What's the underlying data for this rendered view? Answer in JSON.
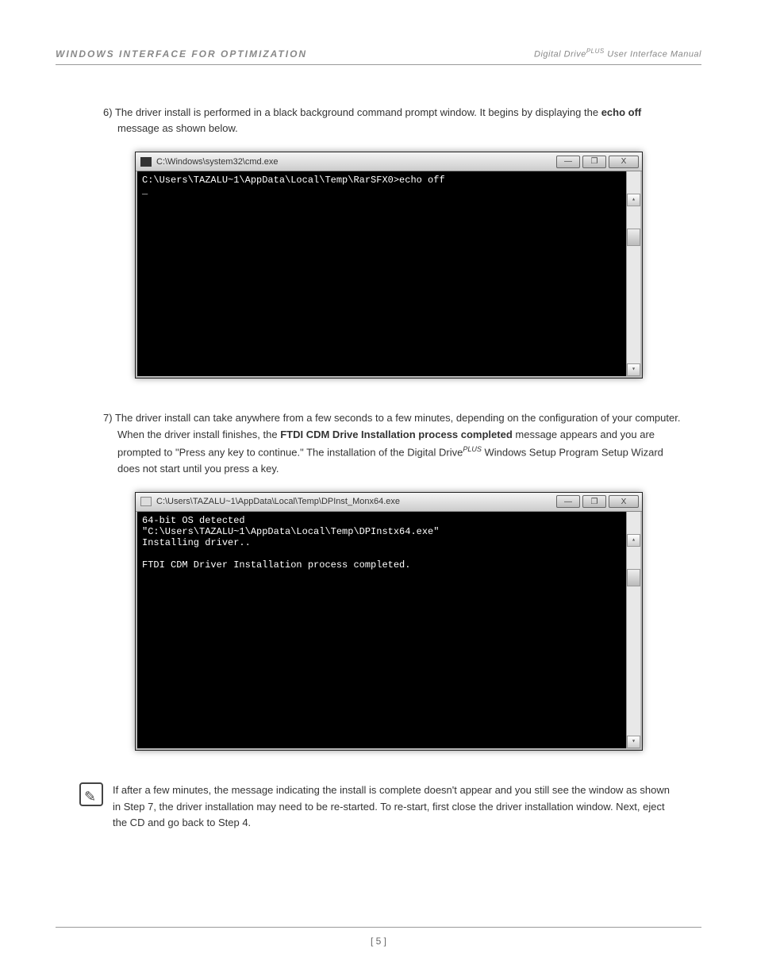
{
  "header": {
    "left": "WINDOWS INTERFACE FOR OPTIMIZATION",
    "right_prefix": "Digital Drive",
    "right_sup": "PLUS",
    "right_suffix": " User Interface Manual"
  },
  "step6": {
    "num": "6) ",
    "text_a": "The driver install is performed in a black background command prompt window. It begins by displaying the ",
    "bold": "echo off",
    "text_b": " message as shown below."
  },
  "cmd1": {
    "title": "C:\\Windows\\system32\\cmd.exe",
    "body": "C:\\Users\\TAZALU~1\\AppData\\Local\\Temp\\RarSFX0>echo off\n_"
  },
  "step7": {
    "num": "7) ",
    "text_a": "The driver install can take anywhere from a few seconds to a few minutes, depending on the configuration of your computer. When the driver install finishes, the ",
    "bold": "FTDI CDM Drive Installation process completed",
    "text_b": " message appears and you are prompted to \"Press any key to continue.\" The installation of the Digital Drive",
    "sup": "PLUS",
    "text_c": " Windows Setup Program Setup Wizard does not start until you press a key."
  },
  "cmd2": {
    "title": "C:\\Users\\TAZALU~1\\AppData\\Local\\Temp\\DPInst_Monx64.exe",
    "body": "64-bit OS detected\n\"C:\\Users\\TAZALU~1\\AppData\\Local\\Temp\\DPInstx64.exe\"\nInstalling driver..\n\nFTDI CDM Driver Installation process completed."
  },
  "note": "If after a few minutes, the message indicating the install is complete doesn't appear and you still see the window as shown in Step 7, the driver installation may need to be re-started. To re-start, first close the driver installation window. Next, eject the CD and go back to Step 4.",
  "buttons": {
    "min": "—",
    "max": "❐",
    "close": "X"
  },
  "scroll": {
    "up": "▴",
    "down": "▾"
  },
  "footer": "[ 5 ]"
}
